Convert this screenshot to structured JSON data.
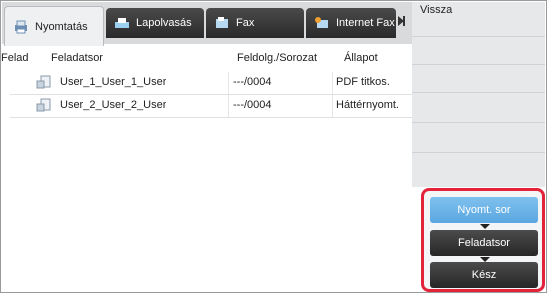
{
  "tabs": [
    {
      "label": "Nyomtatás",
      "icon": "print-icon",
      "active": true
    },
    {
      "label": "Lapolvasás",
      "icon": "scan-icon",
      "active": false
    },
    {
      "label": "Fax",
      "icon": "fax-icon",
      "active": false
    },
    {
      "label": "Internet Fax",
      "icon": "internet-fax-icon",
      "active": false
    }
  ],
  "side": {
    "back_label": "Vissza"
  },
  "table": {
    "headers": {
      "sender": "Felad",
      "job": "Feladatsor",
      "progress": "Feldolg./Sorozat",
      "status": "Állapot"
    },
    "rows": [
      {
        "name": "User_1_User_1_User",
        "progress": "---/0004",
        "status": "PDF titkos."
      },
      {
        "name": "User_2_User_2_User",
        "progress": "---/0004",
        "status": "Háttérnyomt."
      }
    ]
  },
  "queue_buttons": {
    "print_queue": "Nyomt. sor",
    "job_queue": "Feladatsor",
    "complete": "Kész"
  },
  "colors": {
    "highlight": "#e2233a",
    "selected": "#6fb6ea",
    "dark": "#2e2e2e"
  }
}
